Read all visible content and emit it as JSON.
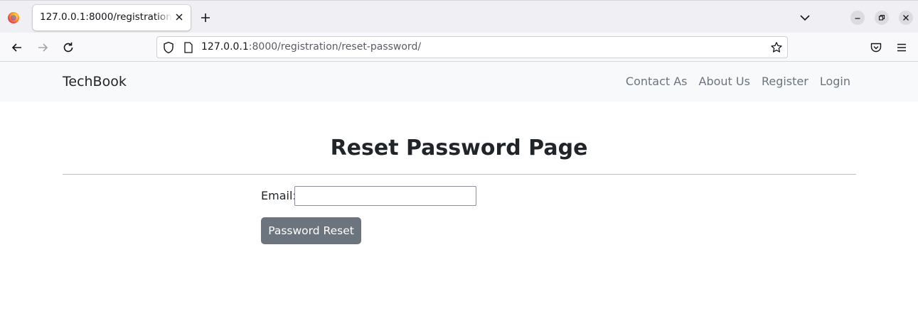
{
  "browser": {
    "tab": {
      "title": "127.0.0.1:8000/registration/reset-password/"
    },
    "url": {
      "host": "127.0.0.1",
      "rest": ":8000/registration/reset-password/"
    },
    "icons": [
      "firefox-logo",
      "close-icon",
      "plus-icon",
      "chevron-down-icon",
      "minimize-icon",
      "restore-icon",
      "close-icon",
      "back-arrow-icon",
      "forward-arrow-icon",
      "reload-icon",
      "shield-icon",
      "page-icon",
      "star-icon",
      "pocket-icon",
      "menu-icon"
    ]
  },
  "site": {
    "brand": "TechBook",
    "nav": [
      "Contact As",
      "About Us",
      "Register",
      "Login"
    ]
  },
  "page": {
    "title": "Reset Password Page",
    "email_label": "Email:",
    "email_value": "",
    "button_label": "Password Reset"
  },
  "colors": {
    "button_bg": "#6c757d",
    "navbar_bg": "#f8f9fa",
    "link": "#6c757d"
  }
}
